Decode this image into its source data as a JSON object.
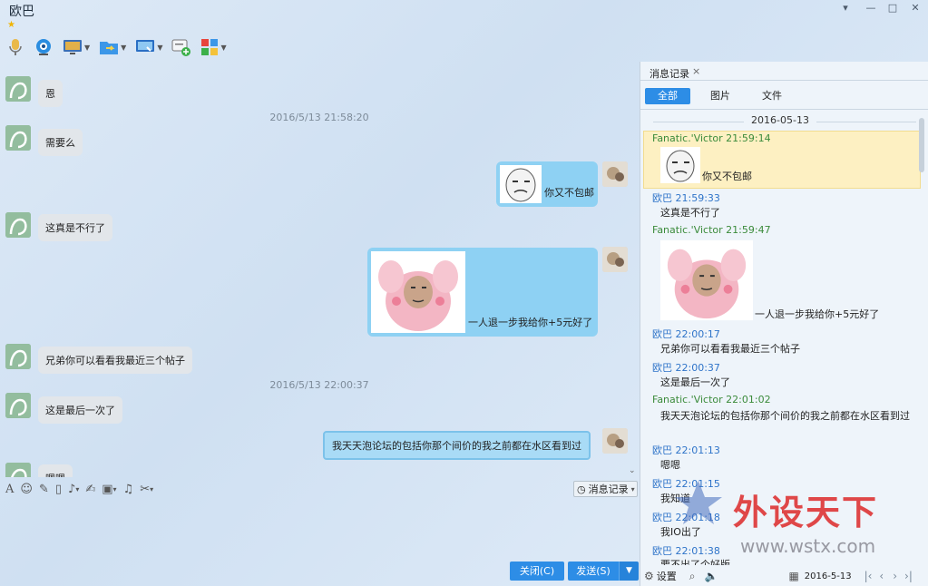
{
  "window": {
    "title": "欧巴"
  },
  "chat": {
    "timestamps": [
      "2016/5/13 21:58:20",
      "2016/5/13 22:00:37"
    ],
    "messages": [
      {
        "text": "恩"
      },
      {
        "text": "需要么"
      },
      {
        "text": "你又不包邮"
      },
      {
        "text": "这真是不行了"
      },
      {
        "text": "一人退一步我给你+5元好了"
      },
      {
        "text": "兄弟你可以看看我最近三个帖子"
      },
      {
        "text": "这是最后一次了"
      },
      {
        "text": "我天天泡论坛的包括你那个间价的我之前都在水区看到过"
      },
      {
        "text": "嗯嗯"
      }
    ]
  },
  "input": {
    "history_label": "消息记录"
  },
  "actions": {
    "close_label": "关闭(C)",
    "send_label": "发送(S)"
  },
  "history": {
    "tab_label": "消息记录",
    "filters": [
      "全部",
      "图片",
      "文件"
    ],
    "date": "2016-05-13",
    "entries": [
      {
        "sender": "Fanatic.'Victor",
        "time": "21:59:14",
        "text": "你又不包邮"
      },
      {
        "sender": "欧巴",
        "time": "21:59:33",
        "text": "这真是不行了"
      },
      {
        "sender": "Fanatic.'Victor",
        "time": "21:59:47",
        "text": "一人退一步我给你+5元好了"
      },
      {
        "sender": "欧巴",
        "time": "22:00:17",
        "text": "兄弟你可以看看我最近三个帖子"
      },
      {
        "sender": "欧巴",
        "time": "22:00:37",
        "text": "这是最后一次了"
      },
      {
        "sender": "Fanatic.'Victor",
        "time": "22:01:02",
        "text": "我天天泡论坛的包括你那个间价的我之前都在水区看到过"
      },
      {
        "sender": "欧巴",
        "time": "22:01:13",
        "text": "嗯嗯"
      },
      {
        "sender": "欧巴",
        "time": "22:01:15",
        "text": "我知道"
      },
      {
        "sender": "欧巴",
        "time": "22:01:18",
        "text": "我IO出了"
      },
      {
        "sender": "欧巴",
        "time": "22:01:38",
        "text": "要不出了个好版"
      }
    ],
    "settings_label": "设置",
    "footer_date": "2016-5-13"
  },
  "watermark": {
    "text": "外设天下",
    "url": "www.wstx.com"
  },
  "colors": {
    "accent": "#2d8de6",
    "self_bubble": "#8ed1f3",
    "other_bubble": "#e2e6ea",
    "highlight": "#fdf0c2",
    "sender_other": "#3b8b3b",
    "sender_self": "#2f74c9"
  }
}
